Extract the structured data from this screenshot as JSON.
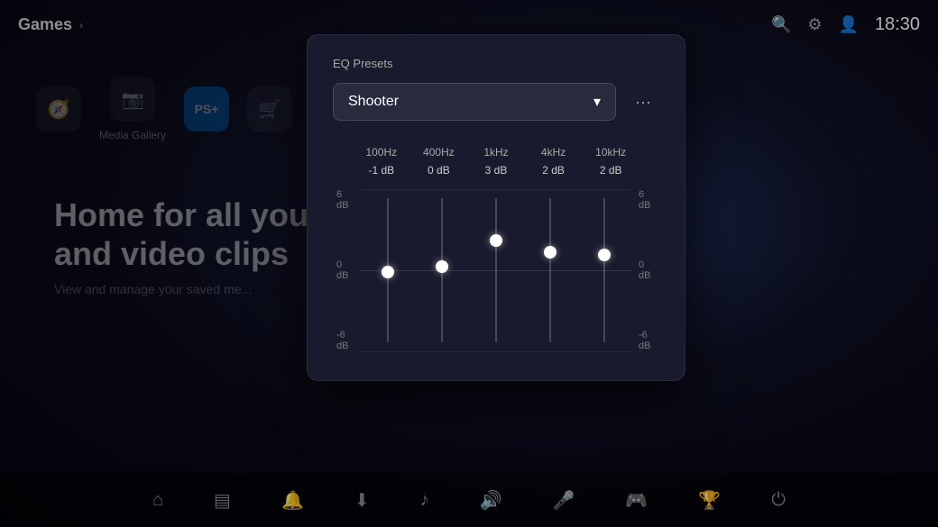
{
  "topbar": {
    "title": "Games",
    "time": "18:30"
  },
  "nav_icons": [
    {
      "id": "discover",
      "symbol": "🧭",
      "label": ""
    },
    {
      "id": "media",
      "symbol": "📷",
      "label": "Media Gallery"
    }
  ],
  "hero": {
    "title_line1": "Home for all your s",
    "title_line2": "and video clips",
    "subtitle": "View and manage your saved me..."
  },
  "eq_modal": {
    "title": "EQ Presets",
    "preset": "Shooter",
    "dropdown_chevron": "▾",
    "more_icon": "···",
    "frequencies": [
      "100Hz",
      "400Hz",
      "1kHz",
      "4kHz",
      "10kHz"
    ],
    "db_values": [
      "-1 dB",
      "0 dB",
      "3 dB",
      "2 dB",
      "2 dB"
    ],
    "left_labels": [
      "6 dB",
      "0 dB",
      "-6 dB"
    ],
    "right_labels": [
      "6 dB",
      "0 dB",
      "-6 dB"
    ],
    "sliders": [
      {
        "freq": "100Hz",
        "db": -1,
        "position_pct": 47
      },
      {
        "freq": "400Hz",
        "db": 0,
        "position_pct": 43
      },
      {
        "freq": "1kHz",
        "db": 3,
        "position_pct": 30
      },
      {
        "freq": "4kHz",
        "db": 2,
        "position_pct": 35
      },
      {
        "freq": "10kHz",
        "db": 2,
        "position_pct": 38
      }
    ]
  },
  "bottom_nav": {
    "items": [
      {
        "id": "home",
        "symbol": "⌂",
        "active": false
      },
      {
        "id": "media",
        "symbol": "▤",
        "active": false
      },
      {
        "id": "bell",
        "symbol": "🔔",
        "active": false
      },
      {
        "id": "download",
        "symbol": "⬇",
        "active": false
      },
      {
        "id": "music",
        "symbol": "♪",
        "active": false
      },
      {
        "id": "volume",
        "symbol": "🔊",
        "active": true
      },
      {
        "id": "mic",
        "symbol": "🎤",
        "active": false
      },
      {
        "id": "gamepad",
        "symbol": "🎮",
        "active": false
      },
      {
        "id": "trophy",
        "symbol": "🏆",
        "active": false
      },
      {
        "id": "power",
        "symbol": "⏻",
        "active": false
      }
    ]
  }
}
